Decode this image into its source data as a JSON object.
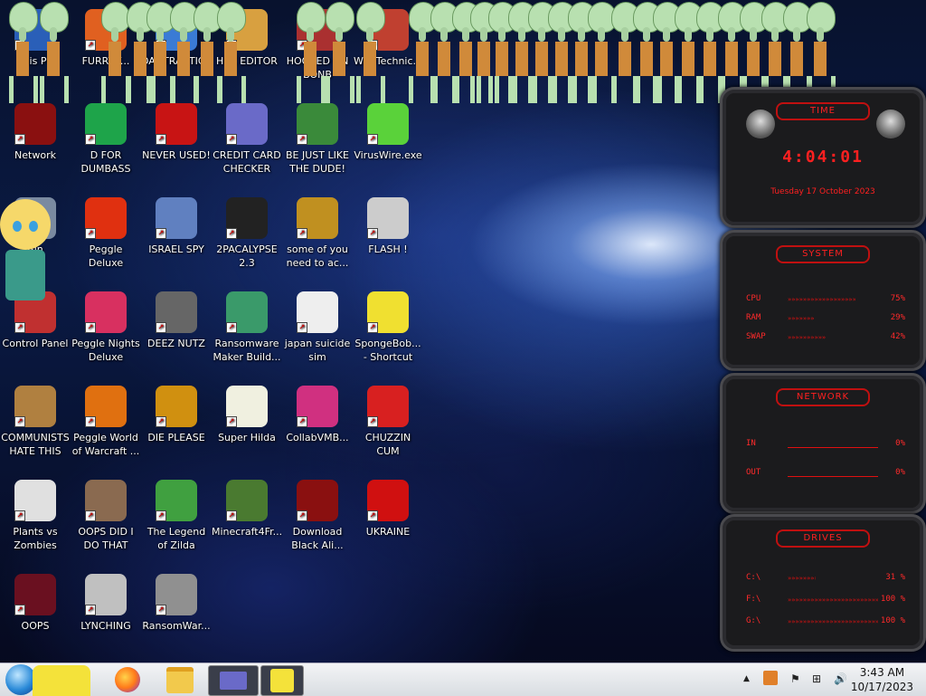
{
  "desktop": {
    "icons": [
      {
        "label": "This PC",
        "icon": "this-pc-icon",
        "color": "#2a5fb8"
      },
      {
        "label": "FURRY.T...",
        "icon": "firefox-icon",
        "color": "#e06020"
      },
      {
        "label": "DANTRACTICA",
        "icon": "app-icon",
        "color": "#3a7bd5"
      },
      {
        "label": "HEX EDITOR",
        "icon": "hex-editor-icon",
        "color": "#d8a040"
      },
      {
        "label": "HOOKED ON BONB",
        "icon": "app-icon",
        "color": "#aa3030"
      },
      {
        "label": "W10Technic...",
        "icon": "technician-icon",
        "color": "#c04030"
      },
      {
        "label": "Network",
        "icon": "network-icon",
        "color": "#8a1010"
      },
      {
        "label": "D FOR DUMBASS",
        "icon": "chat-icon",
        "color": "#1ea44a"
      },
      {
        "label": "NEVER USED!",
        "icon": "dev-cpp-icon",
        "color": "#c81414"
      },
      {
        "label": "CREDIT CARD CHECKER",
        "icon": "credit-card-icon",
        "color": "#6a6ac8"
      },
      {
        "label": "BE JUST LIKE THE DUDE!",
        "icon": "santa-icon",
        "color": "#3a8a3a"
      },
      {
        "label": "VirusWire.exe",
        "icon": "limewire-icon",
        "color": "#5ad23a"
      },
      {
        "label": "Bin",
        "icon": "recycle-bin-icon",
        "color": "#7a8aa0"
      },
      {
        "label": "Peggle Deluxe",
        "icon": "peggle-icon",
        "color": "#e03010"
      },
      {
        "label": "ISRAEL SPY",
        "icon": "spy-icon",
        "color": "#6080c0"
      },
      {
        "label": "2PACALYPSE 2.3",
        "icon": "terminal-icon",
        "color": "#222222"
      },
      {
        "label": "some of you need to ac...",
        "icon": "dog-icon",
        "color": "#c09020"
      },
      {
        "label": "FLASH !",
        "icon": "flash-icon",
        "color": "#cccccc"
      },
      {
        "label": "Control Panel",
        "icon": "control-panel-icon",
        "color": "#c03030"
      },
      {
        "label": "Peggle Nights Deluxe",
        "icon": "peggle-icon",
        "color": "#d83060"
      },
      {
        "label": "DEEZ NUTZ",
        "icon": "stack-icon",
        "color": "#666666"
      },
      {
        "label": "Ransomware Maker Build...",
        "icon": "window-icon",
        "color": "#3a9a6a"
      },
      {
        "label": "japan suicide sim",
        "icon": "document-icon",
        "color": "#eeeeee"
      },
      {
        "label": "SpongeBob... - Shortcut",
        "icon": "spongebob-icon",
        "color": "#f0e030"
      },
      {
        "label": "COMMUNISTS HATE THIS G...",
        "icon": "money-bag-icon",
        "color": "#b08040"
      },
      {
        "label": "Peggle World of Warcraft ...",
        "icon": "peggle-icon",
        "color": "#e07010"
      },
      {
        "label": "DIE PLEASE",
        "icon": "de-icon",
        "color": "#d09010"
      },
      {
        "label": "Super Hilda",
        "icon": "pixel-icon",
        "color": "#f0f0e0"
      },
      {
        "label": "CollabVMB...",
        "icon": "collabvm-icon",
        "color": "#d03080"
      },
      {
        "label": "CHUZZIN CUM",
        "icon": "chuzzle-icon",
        "color": "#d82020"
      },
      {
        "label": "Plants vs Zombies",
        "icon": "flower-icon",
        "color": "#e0e0e0"
      },
      {
        "label": "OOPS DID I DO THAT",
        "icon": "portrait-icon",
        "color": "#8a6a50"
      },
      {
        "label": "The Legend of Zilda",
        "icon": "zelda-icon",
        "color": "#40a040"
      },
      {
        "label": "Minecraft4Fr...",
        "icon": "minecraft-icon",
        "color": "#4a7a30"
      },
      {
        "label": "Download Black Ali...",
        "icon": "alien-icon",
        "color": "#8a1010"
      },
      {
        "label": "UKRAINE",
        "icon": "radiation-icon",
        "color": "#d01010"
      },
      {
        "label": "OOPS",
        "icon": "book-icon",
        "color": "#6a1020"
      },
      {
        "label": "LYNCHING",
        "icon": "knot-icon",
        "color": "#c0c0c0"
      },
      {
        "label": "RansomWar...",
        "icon": "skull-icon",
        "color": "#909090"
      }
    ]
  },
  "gadgets": {
    "time": {
      "title": "TIME",
      "clock": "4:04:01",
      "date": "Tuesday 17 October 2023"
    },
    "system": {
      "title": "SYSTEM",
      "rows": [
        {
          "key": "CPU",
          "value": "75%",
          "level": 0.75
        },
        {
          "key": "RAM",
          "value": "29%",
          "level": 0.29
        },
        {
          "key": "SWAP",
          "value": "42%",
          "level": 0.42
        }
      ]
    },
    "network": {
      "title": "NETWORK",
      "rows": [
        {
          "key": "IN",
          "value": "0%"
        },
        {
          "key": "OUT",
          "value": "0%"
        }
      ]
    },
    "drives": {
      "title": "DRIVES",
      "rows": [
        {
          "key": "C:\\",
          "value": "31 %",
          "level": 0.31
        },
        {
          "key": "F:\\",
          "value": "100 %",
          "level": 1.0
        },
        {
          "key": "G:\\",
          "value": "100 %",
          "level": 1.0
        }
      ]
    }
  },
  "taskbar": {
    "pinned": [
      "start-orb-icon",
      "spongebob-icon",
      "firefox-icon",
      "file-explorer-icon",
      "credit-card-app-icon",
      "spongebob-app-icon"
    ],
    "tray": {
      "chevron": "▲",
      "flag": "⚑",
      "network": "⊞",
      "volume": "🔊"
    },
    "clock": {
      "time": "3:43 AM",
      "date": "10/17/2023"
    }
  }
}
